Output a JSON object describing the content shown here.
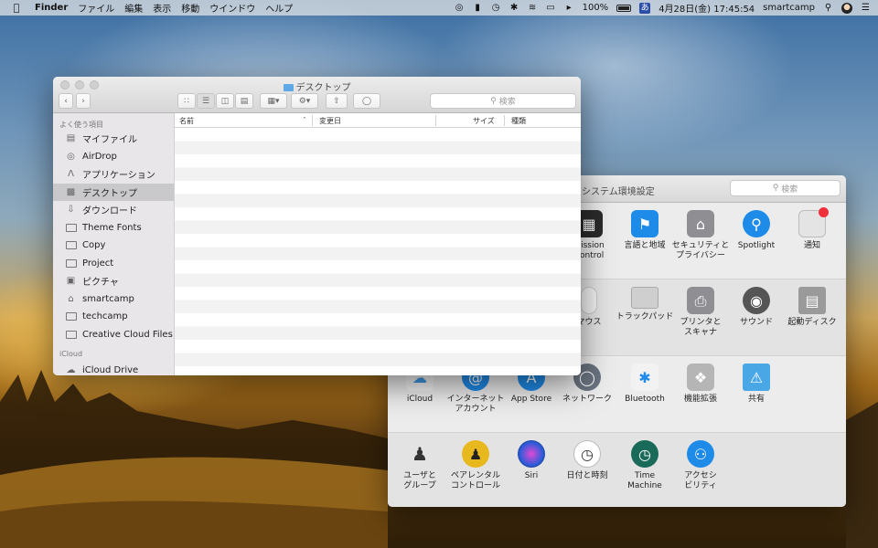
{
  "menubar": {
    "app": "Finder",
    "menus": [
      "ファイル",
      "編集",
      "表示",
      "移動",
      "ウインドウ",
      "ヘルプ"
    ],
    "battery": "100%",
    "input_source": "あ",
    "datetime": "4月28日(金)  17:45:54",
    "user": "smartcamp"
  },
  "finder": {
    "title": "デスクトップ",
    "search_placeholder": "検索",
    "sidebar_heading_favorites": "よく使う項目",
    "sidebar_items": [
      {
        "label": "マイファイル",
        "icon": "all-files-icon"
      },
      {
        "label": "AirDrop",
        "icon": "airdrop-icon"
      },
      {
        "label": "アプリケーション",
        "icon": "applications-icon"
      },
      {
        "label": "デスクトップ",
        "icon": "desktop-icon"
      },
      {
        "label": "ダウンロード",
        "icon": "downloads-icon"
      },
      {
        "label": "Theme Fonts",
        "icon": "folder-icon"
      },
      {
        "label": "Copy",
        "icon": "folder-icon"
      },
      {
        "label": "Project",
        "icon": "folder-icon"
      },
      {
        "label": "ピクチャ",
        "icon": "pictures-icon"
      },
      {
        "label": "smartcamp",
        "icon": "home-icon"
      },
      {
        "label": "techcamp",
        "icon": "folder-icon"
      },
      {
        "label": "Creative Cloud Files",
        "icon": "folder-icon"
      }
    ],
    "selected_item": "デスクトップ",
    "sidebar_heading_icloud": "iCloud",
    "icloud_item": "iCloud Drive",
    "columns": [
      "名前",
      "変更日",
      "サイズ",
      "種類"
    ]
  },
  "syspref": {
    "title": "システム環境設定",
    "search_placeholder": "検索",
    "row1": [
      "Mission\nControl",
      "言語と地域",
      "セキュリティと\nプライバシー",
      "Spotlight",
      "通知"
    ],
    "row2": [
      "マウス",
      "トラックパッド",
      "プリンタと\nスキャナ",
      "サウンド",
      "起動ディスク"
    ],
    "row3": [
      "iCloud",
      "インターネット\nアカウント",
      "App Store",
      "ネットワーク",
      "Bluetooth",
      "機能拡張",
      "共有"
    ],
    "row4": [
      "ユーザと\nグループ",
      "ペアレンタル\nコントロール",
      "Siri",
      "日付と時刻",
      "Time\nMachine",
      "アクセシ\nビリティ"
    ],
    "colors": {
      "blue": "#1f8be8",
      "gray": "#8e8e93",
      "gold": "#e8b81f",
      "red": "#f0303a"
    }
  }
}
